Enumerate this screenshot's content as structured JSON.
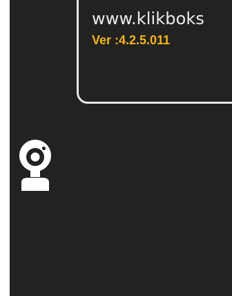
{
  "info_panel": {
    "website": "www.klikboks",
    "version": "Ver :4.2.5.011"
  },
  "colors": {
    "background": "#222220",
    "panel_border": "#e8e8e6",
    "url_text": "#ececea",
    "version_text": "#f2b51c",
    "icon": "#ffffff"
  },
  "icons": {
    "camera": "webcam-icon"
  }
}
